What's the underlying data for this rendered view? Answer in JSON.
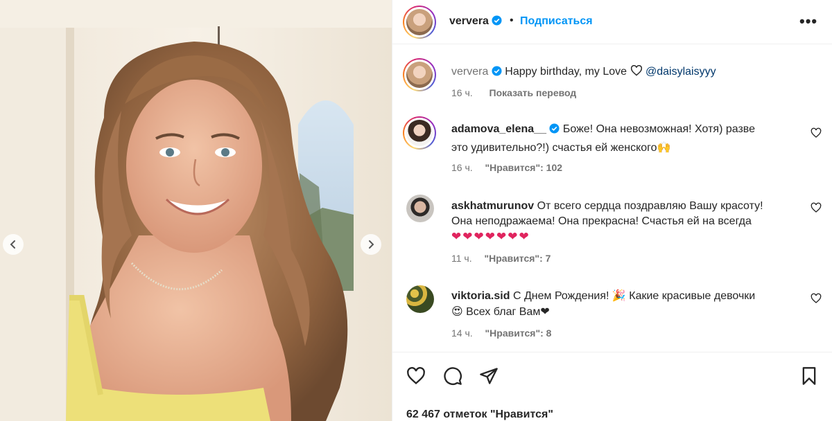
{
  "post": {
    "media_nav": {
      "prev_icon": "chevron-left-icon",
      "next_icon": "chevron-right-icon"
    },
    "author": {
      "username": "ververa",
      "verified": true,
      "separator": "•",
      "follow_label": "Подписаться",
      "more_label": "•••"
    },
    "caption": {
      "username": "ververa",
      "text": "Happy birthday, my Love",
      "mention": "@daisylaisyyy",
      "time": "16 ч.",
      "translate_label": "Показать перевод"
    },
    "comments": [
      {
        "username": "adamova_elena__",
        "verified": true,
        "line1": "Боже! Она невозможная! Хотя) разве",
        "line2": "это удивительно?!) счастья ей женского🙌",
        "time": "16 ч.",
        "likes": "\"Нравится\": 102"
      },
      {
        "username": "askhatmurunov",
        "verified": false,
        "line1": "От всего сердца поздравляю Вашу красоту!",
        "line2": "Она неподражаема! Она прекрасна! Счастья ей на всегда",
        "line3": "❤❤❤❤❤❤❤",
        "time": "11 ч.",
        "likes": "\"Нравится\": 7"
      },
      {
        "username": "viktoria.sid",
        "verified": false,
        "line1": "С Днем Рождения! 🎉 Какие красивые девочки",
        "line2": "😍 Всех благ Вам❤",
        "time": "14 ч.",
        "likes": "\"Нравится\": 8"
      }
    ],
    "likes_count": "62 467 отметок \"Нравится\"",
    "colors": {
      "link": "#0095f6",
      "mention": "#00376b",
      "muted": "#737373",
      "text": "#262626"
    }
  }
}
